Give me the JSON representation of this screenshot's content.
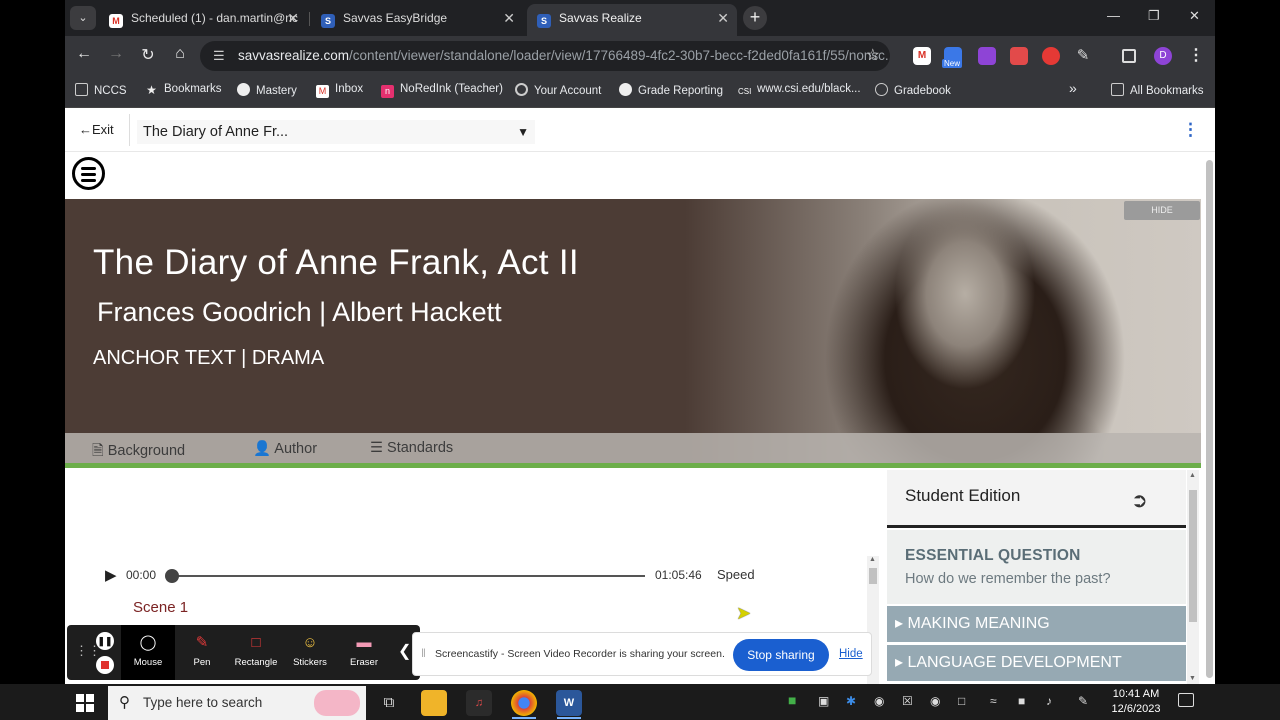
{
  "browser": {
    "tabs": [
      {
        "title": "Scheduled (1) - dan.martin@nc",
        "icon": "gmail-icon"
      },
      {
        "title": "Savvas EasyBridge",
        "icon": "savvas-icon"
      },
      {
        "title": "Savvas Realize",
        "icon": "savvas-icon",
        "active": true
      }
    ],
    "url_host": "savvasrealize.com",
    "url_path": "/content/viewer/standalone/loader/view/17766489-4fc2-30b7-becc-f2ded0fa161f/55/nonsc...",
    "bookmarks": [
      "NCCS",
      "Bookmarks",
      "Mastery",
      "Inbox",
      "NoRedInk (Teacher)",
      "Your Account",
      "Grade Reporting",
      "www.csi.edu/black...",
      "Gradebook"
    ],
    "all_bookmarks": "All Bookmarks",
    "ext_new_badge": "New",
    "profile_initial": "D"
  },
  "viewer": {
    "exit_label": "Exit",
    "document_title": "The Diary of Anne Fr...",
    "hide_label": "HIDE"
  },
  "hero": {
    "title": "The Diary of Anne Frank, Act II",
    "authors": "Frances Goodrich | Albert Hackett",
    "genre": "ANCHOR TEXT | DRAMA",
    "tabs": {
      "background": "Background",
      "author": "Author",
      "standards": "Standards"
    }
  },
  "audio": {
    "current_time": "00:00",
    "duration": "01:05:46",
    "speed_label": "Speed",
    "progress": 0
  },
  "content": {
    "scene": "Scene 1"
  },
  "sidebar": {
    "edition": "Student Edition",
    "essential_question_title": "ESSENTIAL QUESTION",
    "essential_question": "How do we remember the past?",
    "sections": [
      "MAKING MEANING",
      "LANGUAGE DEVELOPMENT"
    ]
  },
  "screencastify": {
    "tools": [
      "Mouse",
      "Pen",
      "Rectangle",
      "Stickers",
      "Eraser"
    ],
    "active_tool": "Mouse",
    "share_message": "Screencastify - Screen Video Recorder is sharing your screen.",
    "stop_label": "Stop sharing",
    "hide_label": "Hide"
  },
  "taskbar": {
    "search_placeholder": "Type here to search",
    "time": "10:41 AM",
    "date": "12/6/2023"
  },
  "colors": {
    "accent_green": "#6cae4a",
    "accordion": "#96a9b3",
    "scene_text": "#7b2323",
    "stop_button": "#1a5fd0"
  }
}
